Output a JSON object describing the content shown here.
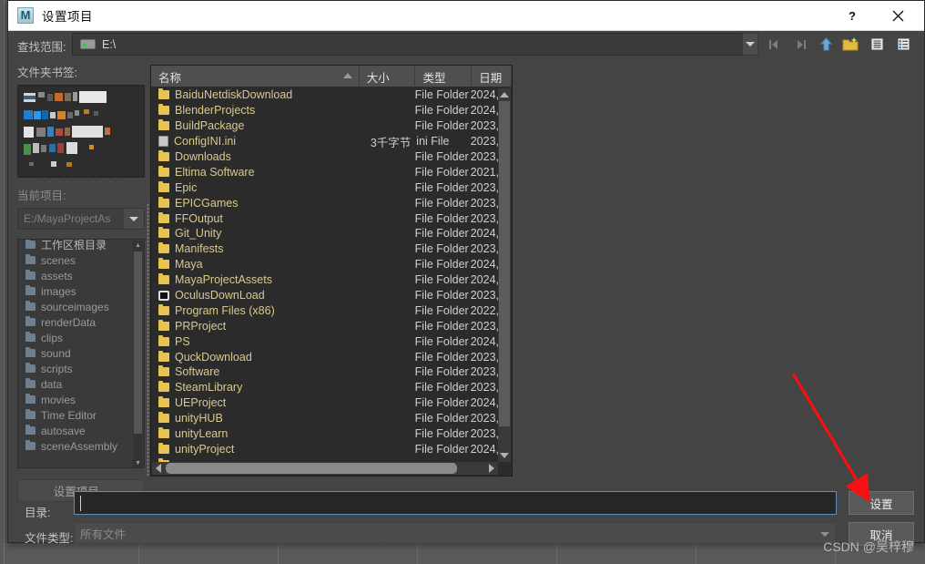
{
  "window": {
    "title": "设置项目",
    "app_icon": "maya-logo-icon",
    "help_label": "?",
    "close_label": "close-icon"
  },
  "pathbar": {
    "label": "查找范围:",
    "value": "E:\\",
    "drive_icon": "drive-icon",
    "dropdown_icon": "chevron-down-icon",
    "tools": [
      {
        "name": "back-icon",
        "glyph": "◀"
      },
      {
        "name": "forward-icon",
        "glyph": "▶"
      },
      {
        "name": "up-folder-icon",
        "glyph": "▲"
      },
      {
        "name": "new-folder-icon",
        "glyph": "📁"
      },
      {
        "name": "list-view-icon",
        "glyph": "▤"
      },
      {
        "name": "detail-view-icon",
        "glyph": "▥"
      }
    ]
  },
  "sidebar": {
    "bookmarks_label": "文件夹书签:",
    "current_project_label": "当前项目:",
    "current_project_value": "E:/MayaProjectAs",
    "set_project_button": "设置项目...",
    "tree_items": [
      {
        "label": "工作区根目录"
      },
      {
        "label": "scenes"
      },
      {
        "label": "assets"
      },
      {
        "label": "images"
      },
      {
        "label": "sourceimages"
      },
      {
        "label": "renderData"
      },
      {
        "label": "clips"
      },
      {
        "label": "sound"
      },
      {
        "label": "scripts"
      },
      {
        "label": "data"
      },
      {
        "label": "movies"
      },
      {
        "label": "Time Editor"
      },
      {
        "label": "autosave"
      },
      {
        "label": "sceneAssembly"
      }
    ]
  },
  "filelist": {
    "columns": [
      {
        "key": "name",
        "label": "名称",
        "sorted": "asc"
      },
      {
        "key": "size",
        "label": "大小"
      },
      {
        "key": "type",
        "label": "类型"
      },
      {
        "key": "date",
        "label": "日期"
      }
    ],
    "rows": [
      {
        "icon": "folder-icon",
        "name": "BaiduNetdiskDownload",
        "size": "",
        "type": "File Folder",
        "date": "2024,"
      },
      {
        "icon": "folder-icon",
        "name": "BlenderProjects",
        "size": "",
        "type": "File Folder",
        "date": "2024,"
      },
      {
        "icon": "folder-icon",
        "name": "BuildPackage",
        "size": "",
        "type": "File Folder",
        "date": "2023,"
      },
      {
        "icon": "ini-file-icon",
        "name": "ConfigINI.ini",
        "size": "3千字节",
        "type": "ini File",
        "date": "2023,"
      },
      {
        "icon": "folder-icon",
        "name": "Downloads",
        "size": "",
        "type": "File Folder",
        "date": "2023,"
      },
      {
        "icon": "folder-icon",
        "name": "Eltima Software",
        "size": "",
        "type": "File Folder",
        "date": "2021,"
      },
      {
        "icon": "folder-icon",
        "name": "Epic",
        "size": "",
        "type": "File Folder",
        "date": "2023,"
      },
      {
        "icon": "folder-icon",
        "name": "EPICGames",
        "size": "",
        "type": "File Folder",
        "date": "2023,"
      },
      {
        "icon": "folder-icon",
        "name": "FFOutput",
        "size": "",
        "type": "File Folder",
        "date": "2023,"
      },
      {
        "icon": "folder-icon",
        "name": "Git_Unity",
        "size": "",
        "type": "File Folder",
        "date": "2024,"
      },
      {
        "icon": "folder-icon",
        "name": "Manifests",
        "size": "",
        "type": "File Folder",
        "date": "2023,"
      },
      {
        "icon": "folder-icon",
        "name": "Maya",
        "size": "",
        "type": "File Folder",
        "date": "2024,"
      },
      {
        "icon": "folder-icon",
        "name": "MayaProjectAssets",
        "size": "",
        "type": "File Folder",
        "date": "2024,"
      },
      {
        "icon": "disc-icon",
        "name": "OculusDownLoad",
        "size": "",
        "type": "File Folder",
        "date": "2023,"
      },
      {
        "icon": "folder-icon",
        "name": "Program Files (x86)",
        "size": "",
        "type": "File Folder",
        "date": "2022,"
      },
      {
        "icon": "folder-icon",
        "name": "PRProject",
        "size": "",
        "type": "File Folder",
        "date": "2023,"
      },
      {
        "icon": "folder-icon",
        "name": "PS",
        "size": "",
        "type": "File Folder",
        "date": "2024,"
      },
      {
        "icon": "folder-icon",
        "name": "QuckDownload",
        "size": "",
        "type": "File Folder",
        "date": "2023,"
      },
      {
        "icon": "folder-icon",
        "name": "Software",
        "size": "",
        "type": "File Folder",
        "date": "2023,"
      },
      {
        "icon": "folder-icon",
        "name": "SteamLibrary",
        "size": "",
        "type": "File Folder",
        "date": "2023,"
      },
      {
        "icon": "folder-icon",
        "name": "UEProject",
        "size": "",
        "type": "File Folder",
        "date": "2024,"
      },
      {
        "icon": "folder-icon",
        "name": "unityHUB",
        "size": "",
        "type": "File Folder",
        "date": "2023,"
      },
      {
        "icon": "folder-icon",
        "name": "unityLearn",
        "size": "",
        "type": "File Folder",
        "date": "2023,"
      },
      {
        "icon": "folder-icon",
        "name": "unityProject",
        "size": "",
        "type": "File Folder",
        "date": "2024,"
      }
    ]
  },
  "bottom": {
    "dir_label": "目录:",
    "dir_value": "",
    "filetype_label": "文件类型:",
    "filetype_value": "所有文件",
    "set_button": "设置",
    "cancel_button": "取消"
  },
  "annotation": {
    "arrow_color": "#f51111",
    "points_to": "设置"
  },
  "watermark": "CSDN @吴梓穆",
  "colors": {
    "dialog_bg": "#444444",
    "list_bg": "#2b2b2b",
    "folder_text": "#d8c98e",
    "titlebar_bg": "#ffffff",
    "focus_border": "#5b8fb9"
  }
}
